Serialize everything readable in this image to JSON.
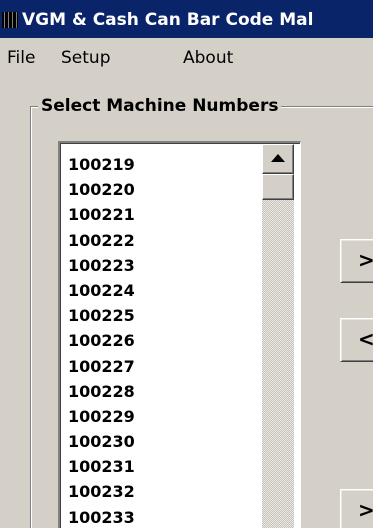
{
  "window": {
    "title": "VGM & Cash Can Bar Code Mal"
  },
  "menu": {
    "items": [
      "File",
      "Setup",
      "About"
    ]
  },
  "group": {
    "label": "Select Machine Numbers",
    "machines": [
      "100219",
      "100220",
      "100221",
      "100222",
      "100223",
      "100224",
      "100225",
      "100226",
      "100227",
      "100228",
      "100229",
      "100230",
      "100231",
      "100232",
      "100233"
    ]
  },
  "buttons": {
    "add_label": ">",
    "remove_label": "<",
    "add_all_label": ">"
  },
  "colors": {
    "titlebar": "#0a246a",
    "face": "#d4d0c8"
  },
  "icons": {
    "app": "barcode-icon",
    "scroll_up": "arrow-up-icon"
  }
}
